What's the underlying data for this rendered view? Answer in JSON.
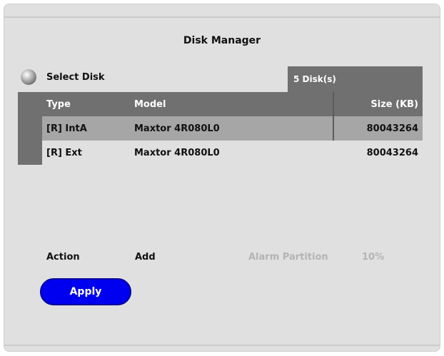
{
  "window": {
    "title": "Disk Manager"
  },
  "select": {
    "label": "Select Disk",
    "icon": "disk-icon",
    "count_label": "5 Disk(s)"
  },
  "table": {
    "headers": {
      "type": "Type",
      "model": "Model",
      "size": "Size (KB)"
    },
    "rows": [
      {
        "type": "[R] IntA",
        "model": "Maxtor 4R080L0",
        "size": "80043264",
        "selected": true
      },
      {
        "type": "[R] Ext",
        "model": "Maxtor 4R080L0",
        "size": "80043264",
        "selected": false
      }
    ]
  },
  "action": {
    "label": "Action",
    "value": "Add"
  },
  "alarm": {
    "label": "Alarm Partition",
    "value": "10%"
  },
  "apply": {
    "label": "Apply"
  },
  "colors": {
    "panel": "#e0e0e0",
    "header": "#707070",
    "selected_row": "#a6a6a6",
    "apply_button": "#0000f0",
    "disabled_text": "#b4b4b4"
  }
}
